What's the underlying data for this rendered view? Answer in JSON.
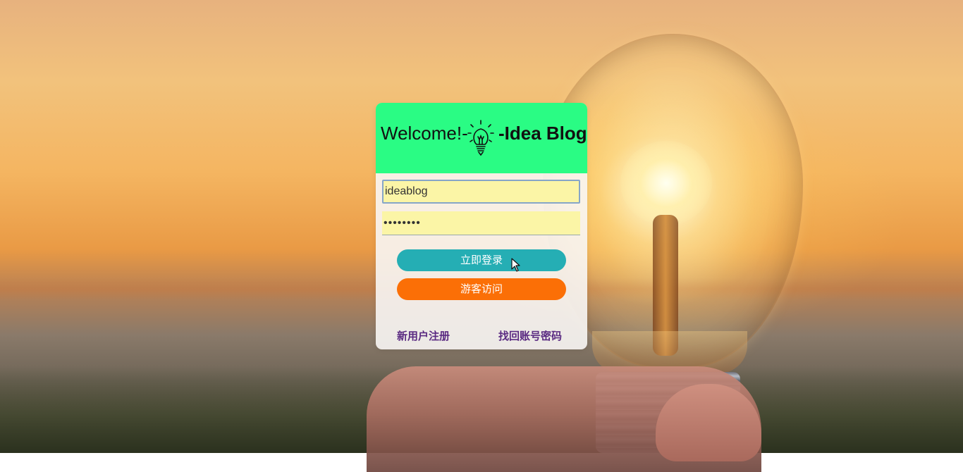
{
  "header": {
    "welcome_text": "Welcome!-",
    "brand_text": "-Idea Blog"
  },
  "form": {
    "username_value": "ideablog",
    "password_mask": "••••••••"
  },
  "buttons": {
    "login_label": "立即登录",
    "guest_label": "游客访问"
  },
  "links": {
    "register_label": "新用户注册",
    "recover_label": "找回账号密码"
  },
  "colors": {
    "header_bg": "#2afc84",
    "login_button": "#25aeb4",
    "guest_button": "#fb6f06",
    "input_bg": "#fbf5a6",
    "link_color": "#5b2b82"
  },
  "icons": {
    "logo": "lightbulb-icon",
    "pointer": "mouse-cursor-icon"
  }
}
